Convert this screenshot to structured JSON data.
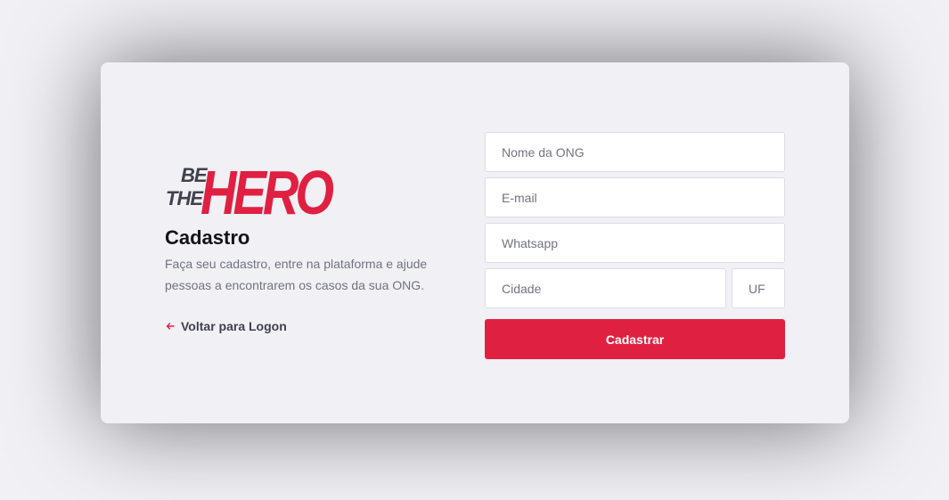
{
  "logo": {
    "line1": "BE",
    "line2": "THE",
    "word": "HERO"
  },
  "page": {
    "title": "Cadastro",
    "description": "Faça seu cadastro, entre na plataforma e ajude pessoas a encontrarem os casos da sua ONG.",
    "back_link": "Voltar para Logon"
  },
  "form": {
    "name_placeholder": "Nome da ONG",
    "email_placeholder": "E-mail",
    "whatsapp_placeholder": "Whatsapp",
    "city_placeholder": "Cidade",
    "uf_placeholder": "UF",
    "submit_label": "Cadastrar"
  },
  "colors": {
    "accent": "#e02041",
    "background": "#f0f0f5",
    "dark_text": "#13131a",
    "muted_text": "#737380",
    "logo_dark": "#41414d"
  },
  "icons": {
    "back": "arrow-left-icon"
  }
}
